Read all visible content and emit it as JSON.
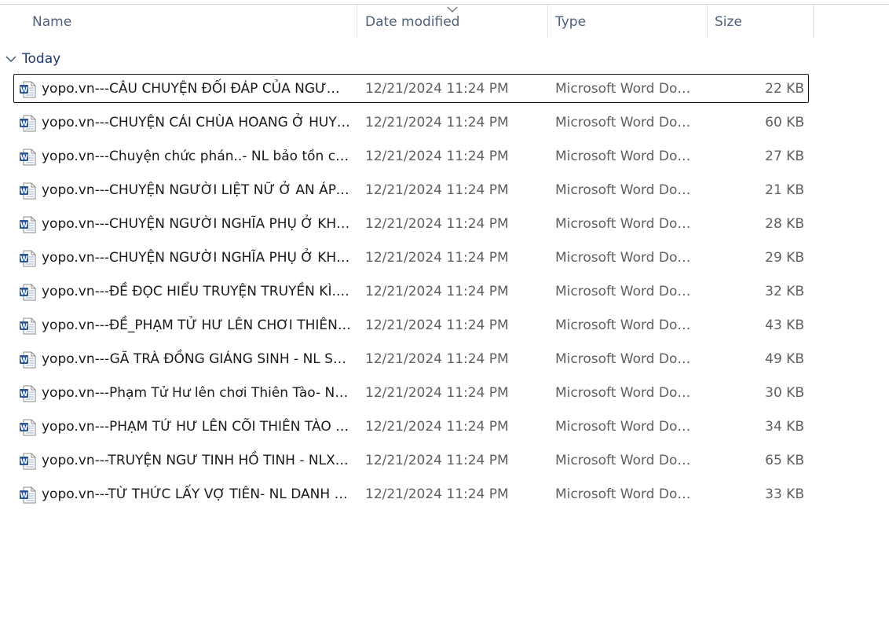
{
  "columns": {
    "name": "Name",
    "date_modified": "Date modified",
    "type": "Type",
    "size": "Size"
  },
  "sort": {
    "column": "date_modified",
    "icon": "chevron-down-icon"
  },
  "group": {
    "label": "Today",
    "icon": "chevron-down-icon"
  },
  "colors": {
    "focus_border": "#1a1a1a",
    "word_icon_blue": "#2b5797",
    "group_text": "#1e3a6e"
  },
  "files": [
    {
      "name": "yopo.vn---CÂU CHUYỆN ĐỐI ĐÁP CỦA NGƯỜI ...",
      "date": "12/21/2024 11:24 PM",
      "type": "Microsoft Word Doc...",
      "size": "22 KB",
      "icon": "word-doc-icon"
    },
    {
      "name": "yopo.vn---CHUYỆN CÁI CHÙA HOANG Ở HUYỆ...",
      "date": "12/21/2024 11:24 PM",
      "type": "Microsoft Word Doc...",
      "size": "60 KB",
      "icon": "word-doc-icon"
    },
    {
      "name": "yopo.vn---Chuyện chức phán..- NL bảo tồn các ...",
      "date": "12/21/2024 11:24 PM",
      "type": "Microsoft Word Doc...",
      "size": "27 KB",
      "icon": "word-doc-icon"
    },
    {
      "name": "yopo.vn---CHUYỆN NGƯỜI LIỆT NỮ Ở AN ÁP-...",
      "date": "12/21/2024 11:24 PM",
      "type": "Microsoft Word Doc...",
      "size": "21 KB",
      "icon": "word-doc-icon"
    },
    {
      "name": "yopo.vn---CHUYỆN NGƯỜI NGHĨA PHỤ Ở KHO...",
      "date": "12/21/2024 11:24 PM",
      "type": "Microsoft Word Doc...",
      "size": "28 KB",
      "icon": "word-doc-icon"
    },
    {
      "name": "yopo.vn---CHUYỆN NGƯỜI NGHĨA PHỤ Ở KHO...",
      "date": "12/21/2024 11:24 PM",
      "type": "Microsoft Word Doc...",
      "size": "29 KB",
      "icon": "word-doc-icon"
    },
    {
      "name": "yopo.vn---ĐỀ ĐỌC HIỂU TRUYỆN TRUYỀN KÌ.d...",
      "date": "12/21/2024 11:24 PM",
      "type": "Microsoft Word Doc...",
      "size": "32 KB",
      "icon": "word-doc-icon"
    },
    {
      "name": "yopo.vn---ĐỀ_PHẠM TỬ HƯ LÊN CHƠI THIÊN T...",
      "date": "12/21/2024 11:24 PM",
      "type": "Microsoft Word Doc...",
      "size": "43 KB",
      "icon": "word-doc-icon"
    },
    {
      "name": "yopo.vn---GÃ TRÀ ĐỒNG GIÁNG SINH - NL SỐ...",
      "date": "12/21/2024 11:24 PM",
      "type": "Microsoft Word Doc...",
      "size": "49 KB",
      "icon": "word-doc-icon"
    },
    {
      "name": "yopo.vn---Phạm Tử Hư lên chơi Thiên Tào- NL ...",
      "date": "12/21/2024 11:24 PM",
      "type": "Microsoft Word Doc...",
      "size": "30 KB",
      "icon": "word-doc-icon"
    },
    {
      "name": "yopo.vn---PHẠM TỨ HƯ LÊN CÕI THIÊN TÀO -...",
      "date": "12/21/2024 11:24 PM",
      "type": "Microsoft Word Doc...",
      "size": "34 KB",
      "icon": "word-doc-icon"
    },
    {
      "name": "yopo.vn---TRUYỆN NGƯ TINH HỒ TINH - NLXH...",
      "date": "12/21/2024 11:24 PM",
      "type": "Microsoft Word Doc...",
      "size": "65 KB",
      "icon": "word-doc-icon"
    },
    {
      "name": "yopo.vn---TỪ THỨC LẤY VỢ TIÊN- NL DANH L...",
      "date": "12/21/2024 11:24 PM",
      "type": "Microsoft Word Doc...",
      "size": "33 KB",
      "icon": "word-doc-icon"
    }
  ]
}
